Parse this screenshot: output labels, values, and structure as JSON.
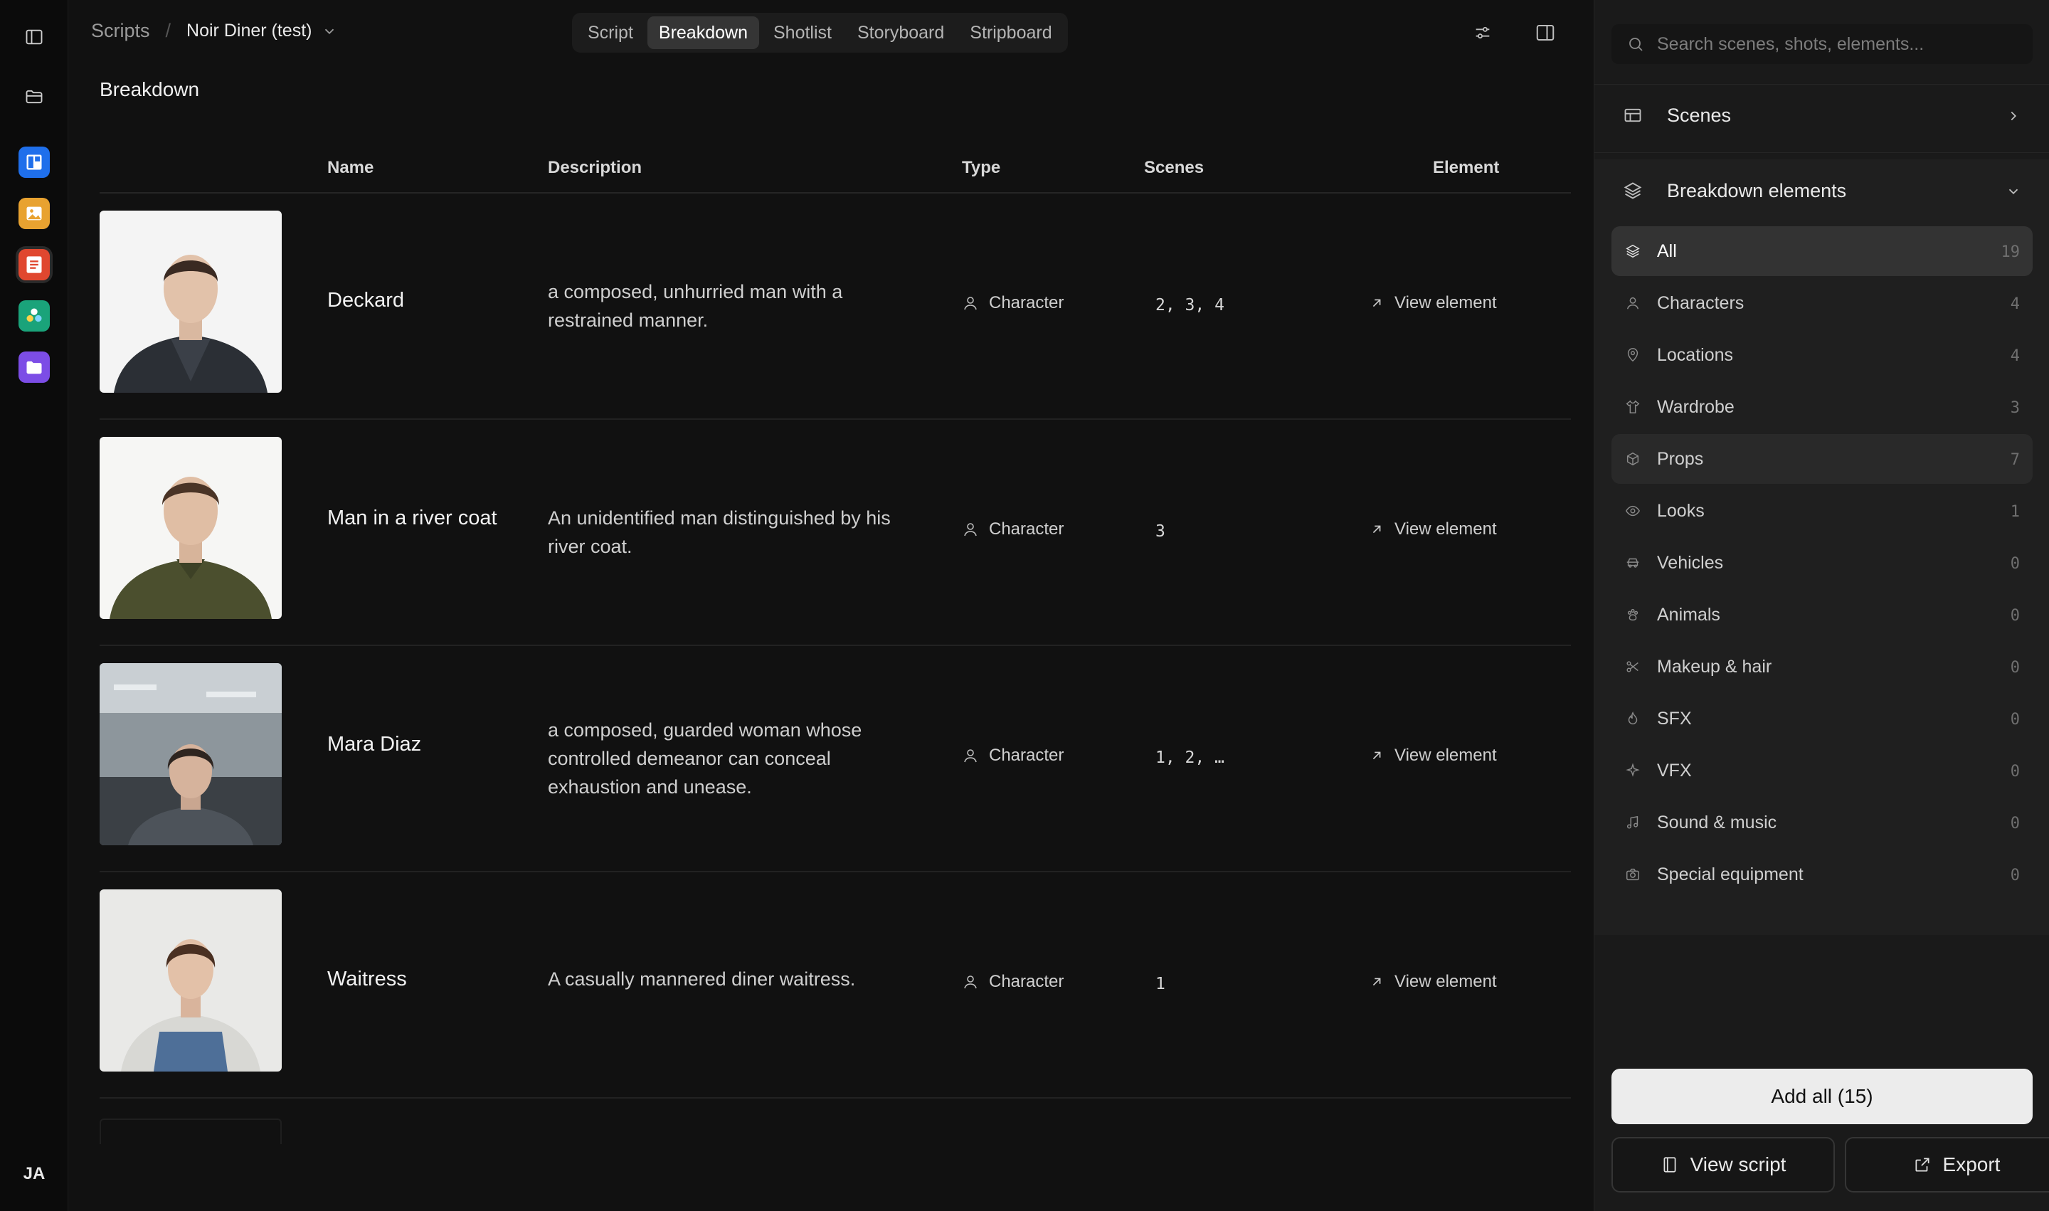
{
  "rail": {
    "user_initials": "JA",
    "apps": [
      {
        "icon": "layout-app-icon",
        "color": "#1f6feb"
      },
      {
        "icon": "image-app-icon",
        "color": "#e8a230"
      },
      {
        "icon": "script-app-icon",
        "color": "#e0472f"
      },
      {
        "icon": "elements-app-icon",
        "color": "#1aa37a"
      },
      {
        "icon": "folder-app-icon",
        "color": "#7c4de6"
      }
    ]
  },
  "header": {
    "breadcrumb_root": "Scripts",
    "breadcrumb_sep": "/",
    "project": "Noir Diner (test)",
    "tabs": [
      {
        "label": "Script",
        "active": false
      },
      {
        "label": "Breakdown",
        "active": true
      },
      {
        "label": "Shotlist",
        "active": false
      },
      {
        "label": "Storyboard",
        "active": false
      },
      {
        "label": "Stripboard",
        "active": false
      }
    ]
  },
  "page": {
    "title": "Breakdown"
  },
  "table": {
    "columns": {
      "name": "Name",
      "description": "Description",
      "type": "Type",
      "scenes": "Scenes",
      "element": "Element"
    },
    "rows": [
      {
        "name": "Deckard",
        "description": "a composed, unhurried man with a restrained manner.",
        "type": "Character",
        "scenes": "2,  3,  4",
        "action": "View element"
      },
      {
        "name": "Man in a river coat",
        "description": "An unidentified man distinguished by his river coat.",
        "type": "Character",
        "scenes": "3",
        "action": "View element"
      },
      {
        "name": "Mara Diaz",
        "description": "a composed, guarded woman whose controlled demeanor can conceal exhaustion and unease.",
        "type": "Character",
        "scenes": "1,  2,  …",
        "action": "View element"
      },
      {
        "name": "Waitress",
        "description": "A casually mannered diner waitress.",
        "type": "Character",
        "scenes": "1",
        "action": "View element"
      }
    ]
  },
  "panel": {
    "search_placeholder": "Search scenes, shots, elements...",
    "scenes_label": "Scenes",
    "breakdown_label": "Breakdown elements",
    "categories": [
      {
        "label": "All",
        "count": "19",
        "icon": "layers-icon"
      },
      {
        "label": "Characters",
        "count": "4",
        "icon": "person-icon"
      },
      {
        "label": "Locations",
        "count": "4",
        "icon": "pin-icon"
      },
      {
        "label": "Wardrobe",
        "count": "3",
        "icon": "shirt-icon"
      },
      {
        "label": "Props",
        "count": "7",
        "icon": "cube-icon"
      },
      {
        "label": "Looks",
        "count": "1",
        "icon": "eye-icon"
      },
      {
        "label": "Vehicles",
        "count": "0",
        "icon": "car-icon"
      },
      {
        "label": "Animals",
        "count": "0",
        "icon": "paw-icon"
      },
      {
        "label": "Makeup & hair",
        "count": "0",
        "icon": "scissors-icon"
      },
      {
        "label": "SFX",
        "count": "0",
        "icon": "flame-icon"
      },
      {
        "label": "VFX",
        "count": "0",
        "icon": "sparkle-icon"
      },
      {
        "label": "Sound & music",
        "count": "0",
        "icon": "music-note-icon"
      },
      {
        "label": "Special equipment",
        "count": "0",
        "icon": "camera-icon"
      }
    ],
    "add_all": "Add all (15)",
    "view_script": "View script",
    "export": "Export"
  }
}
